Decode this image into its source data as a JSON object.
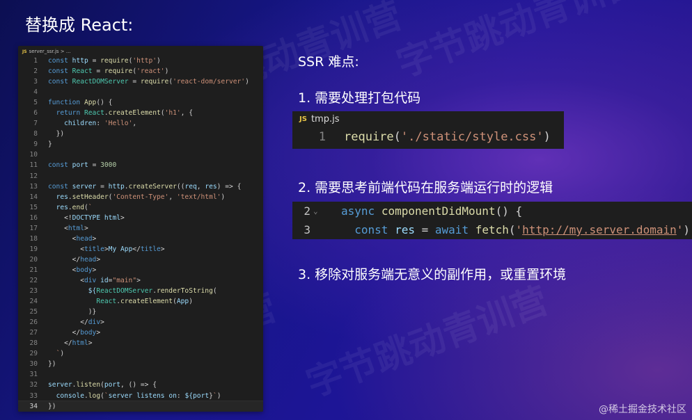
{
  "page": {
    "title": "替换成 React:"
  },
  "watermarks": [
    "字节跳动青训营",
    "字节跳动青训营",
    "字节跳动青训营",
    "字节跳动青训营"
  ],
  "editor": {
    "tab_badge": "JS",
    "tab_label": "server_ssr.js > ...",
    "active_line": 34,
    "lines": [
      "const http = require('http')",
      "const React = require('react')",
      "const ReactDOMServer = require('react-dom/server')",
      "",
      "function App() {",
      "  return React.createElement('h1', {",
      "    children: 'Hello',",
      "  })",
      "}",
      "",
      "const port = 3000",
      "",
      "const server = http.createServer((req, res) => {",
      "  res.setHeader('Content-Type', 'text/html')",
      "  res.end(`",
      "    <!DOCTYPE html>",
      "    <html>",
      "      <head>",
      "        <title>My App</title>",
      "      </head>",
      "      <body>",
      "        <div id=\"main\">",
      "          ${ReactDOMServer.renderToString(",
      "            React.createElement(App)",
      "          )}",
      "        </div>",
      "      </body>",
      "    </html>",
      "  `)",
      "})",
      "",
      "server.listen(port, () => {",
      "  console.log(`server listens on: ${port}`)",
      "})"
    ]
  },
  "right": {
    "heading": "SSR 难点:",
    "points": [
      "1. 需要处理打包代码",
      "2. 需要思考前端代码在服务端运行时的逻辑",
      "3. 移除对服务端无意义的副作用，或重置环境"
    ],
    "snippet1": {
      "tab_badge": "JS",
      "tab_label": "tmp.js",
      "line_no": "1",
      "code": "require('./static/style.css')"
    },
    "snippet2": {
      "lines": [
        {
          "no": "2",
          "code": "async componentDidMount() {"
        },
        {
          "no": "3",
          "code": "  const res = await fetch('http://my.server.domain')"
        }
      ]
    }
  },
  "footer": {
    "text": "@稀土掘金技术社区"
  }
}
